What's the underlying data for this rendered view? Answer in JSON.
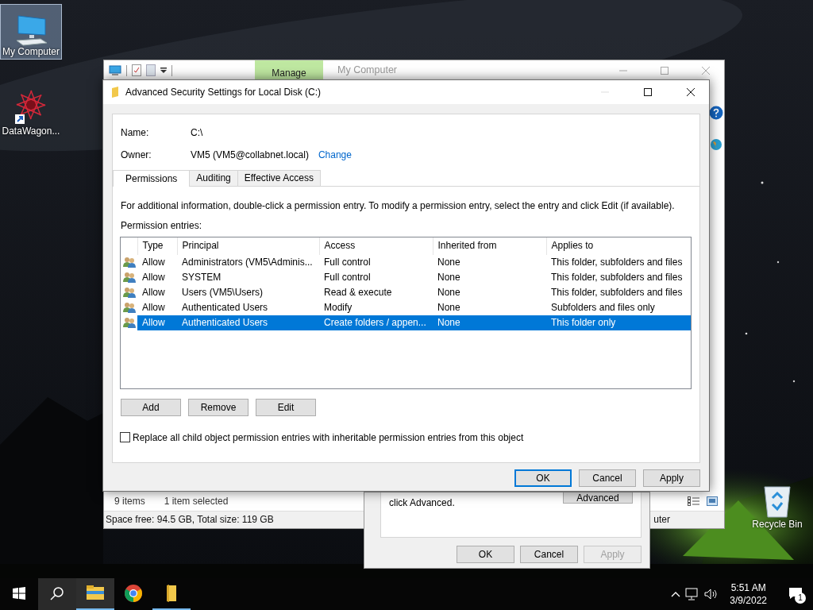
{
  "desktop_icons": [
    {
      "label": "My Computer",
      "kind": "computer",
      "selected": true
    },
    {
      "label": "DataWagon...",
      "kind": "shortcut",
      "selected": false
    },
    {
      "label": "Recycle Bin",
      "kind": "recycle",
      "selected": false
    }
  ],
  "explorer": {
    "ribbon_tab": "Manage",
    "title": "My Computer",
    "item_count": "9 items",
    "selection": "1 item selected",
    "drive_info": "Space free: 94.5 GB, Total size: 119 GB",
    "status_right": "uter"
  },
  "properties": {
    "text": "click Advanced.",
    "advanced_button": "Advanced",
    "buttons": [
      {
        "label": "OK",
        "disabled": false
      },
      {
        "label": "Cancel",
        "disabled": false
      },
      {
        "label": "Apply",
        "disabled": true
      }
    ]
  },
  "dialog": {
    "title": "Advanced Security Settings for Local Disk (C:)",
    "name_label": "Name:",
    "name": "C:\\",
    "owner_label": "Owner:",
    "owner": "VM5 (VM5@collabnet.local)",
    "change_link": "Change",
    "tabs": [
      {
        "label": "Permissions",
        "selected": true
      },
      {
        "label": "Auditing",
        "selected": false
      },
      {
        "label": "Effective Access",
        "selected": false
      }
    ],
    "info": "For additional information, double-click a permission entry. To modify a permission entry, select the entry and click Edit (if available).",
    "entries_label": "Permission entries:",
    "columns": [
      "Type",
      "Principal",
      "Access",
      "Inherited from",
      "Applies to"
    ],
    "rows": [
      {
        "type": "Allow",
        "principal": "Administrators (VM5\\Adminis...",
        "access": "Full control",
        "inherited": "None",
        "applies": "This folder, subfolders and files",
        "selected": false
      },
      {
        "type": "Allow",
        "principal": "SYSTEM",
        "access": "Full control",
        "inherited": "None",
        "applies": "This folder, subfolders and files",
        "selected": false
      },
      {
        "type": "Allow",
        "principal": "Users (VM5\\Users)",
        "access": "Read & execute",
        "inherited": "None",
        "applies": "This folder, subfolders and files",
        "selected": false
      },
      {
        "type": "Allow",
        "principal": "Authenticated Users",
        "access": "Modify",
        "inherited": "None",
        "applies": "Subfolders and files only",
        "selected": false
      },
      {
        "type": "Allow",
        "principal": "Authenticated Users",
        "access": "Create folders / appen...",
        "inherited": "None",
        "applies": "This folder only",
        "selected": true
      }
    ],
    "entry_buttons": [
      "Add",
      "Remove",
      "Edit"
    ],
    "replace_option": {
      "label": "Replace all child object permission entries with inheritable permission entries from this object",
      "checked": false
    },
    "buttons": [
      {
        "label": "OK",
        "default": true
      },
      {
        "label": "Cancel",
        "default": false
      },
      {
        "label": "Apply",
        "default": false
      }
    ]
  },
  "taskbar": {
    "apps": [
      {
        "kind": "explorer",
        "running": true,
        "active": true
      },
      {
        "kind": "chrome",
        "running": false,
        "active": false
      },
      {
        "kind": "notepad",
        "running": true,
        "active": false
      }
    ],
    "time": "5:51 AM",
    "date": "3/9/2022",
    "notification_count": "1"
  }
}
